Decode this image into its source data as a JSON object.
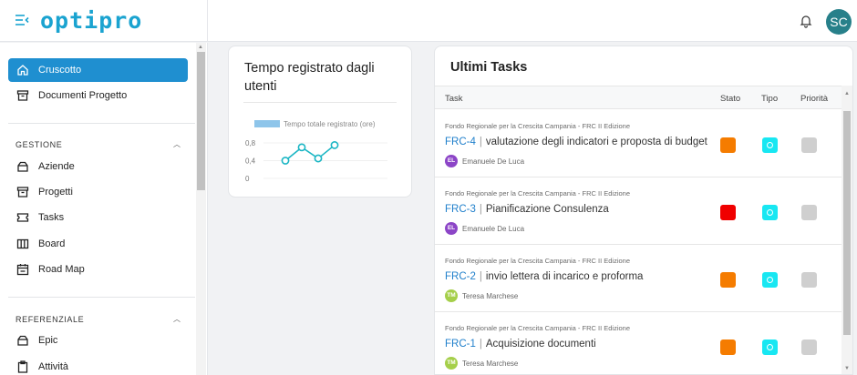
{
  "brand": {
    "logo_text": "optipro",
    "color": "#1aa3d0"
  },
  "topbar": {
    "user_initials": "SC",
    "avatar_color": "#27808a",
    "icons": [
      "menu-collapse-icon",
      "bell-icon"
    ]
  },
  "sidebar": {
    "top_items": [
      {
        "label": "Cruscotto",
        "icon": "home-icon",
        "active": true
      },
      {
        "label": "Documenti Progetto",
        "icon": "archive-icon",
        "active": false
      }
    ],
    "sections": [
      {
        "title": "GESTIONE",
        "items": [
          {
            "label": "Aziende",
            "icon": "building-icon"
          },
          {
            "label": "Progetti",
            "icon": "archive-icon"
          },
          {
            "label": "Tasks",
            "icon": "ticket-icon"
          },
          {
            "label": "Board",
            "icon": "columns-icon"
          },
          {
            "label": "Road Map",
            "icon": "calendar-icon"
          }
        ]
      },
      {
        "title": "REFERENZIALE",
        "items": [
          {
            "label": "Epic",
            "icon": "building-icon"
          },
          {
            "label": "Attività",
            "icon": "clipboard-icon"
          }
        ]
      }
    ]
  },
  "time_card": {
    "title": "Tempo registrato dagli utenti",
    "chart_data": {
      "type": "line",
      "series": [
        {
          "name": "Tempo totale registrato (ore)",
          "values": [
            0.4,
            0.7,
            0.45,
            0.75
          ]
        }
      ],
      "y_ticks": [
        "0,8",
        "0,4",
        "0"
      ],
      "ylim": [
        0,
        0.8
      ],
      "legend_color": "#8ec5ea",
      "line_color": "#1bb6c4"
    }
  },
  "tasks_card": {
    "title": "Ultimi Tasks",
    "columns": [
      "Task",
      "Stato",
      "Tipo",
      "Priorità"
    ],
    "rows": [
      {
        "project": "Fondo Regionale per la Crescita Campania - FRC II Edizione",
        "code": "FRC-4",
        "name": "valutazione degli indicatori e proposta di budget",
        "assignee": "Emanuele De Luca",
        "initials": "EL",
        "avatar_color": "#8c45c7",
        "stato_color": "#f57c00",
        "tipo_color": "#18e7f2",
        "prio_color": "#cfcfcf"
      },
      {
        "project": "Fondo Regionale per la Crescita Campania - FRC II Edizione",
        "code": "FRC-3",
        "name": "Pianificazione Consulenza",
        "assignee": "Emanuele De Luca",
        "initials": "EL",
        "avatar_color": "#8c45c7",
        "stato_color": "#f00000",
        "tipo_color": "#18e7f2",
        "prio_color": "#cfcfcf"
      },
      {
        "project": "Fondo Regionale per la Crescita Campania - FRC II Edizione",
        "code": "FRC-2",
        "name": "invio lettera di incarico e proforma",
        "assignee": "Teresa Marchese",
        "initials": "TM",
        "avatar_color": "#a5cf4a",
        "stato_color": "#f57c00",
        "tipo_color": "#18e7f2",
        "prio_color": "#cfcfcf"
      },
      {
        "project": "Fondo Regionale per la Crescita Campania - FRC II Edizione",
        "code": "FRC-1",
        "name": "Acquisizione documenti",
        "assignee": "Teresa Marchese",
        "initials": "TM",
        "avatar_color": "#a5cf4a",
        "stato_color": "#f57c00",
        "tipo_color": "#18e7f2",
        "prio_color": "#cfcfcf"
      }
    ]
  }
}
